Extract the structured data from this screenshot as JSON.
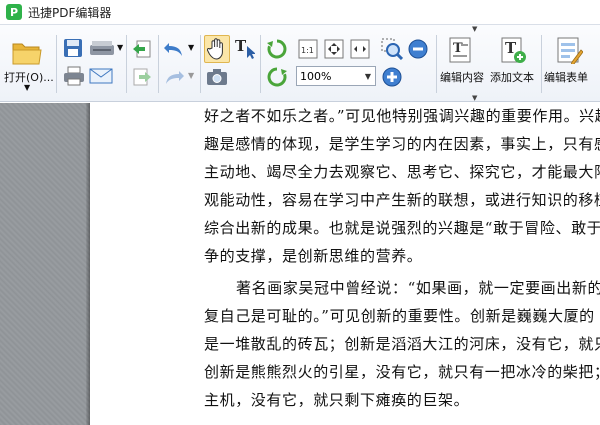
{
  "window": {
    "title": "迅捷PDF编辑器",
    "logo_letter": "P"
  },
  "toolbar": {
    "open_label": "打开(O)...",
    "zoom": {
      "value": "100%"
    },
    "edit_content_label": "编辑内容",
    "add_text_label": "添加文本",
    "edit_form_label": "编辑表单"
  },
  "document": {
    "lines": [
      "好之者不如乐之者。”可见他特别强调兴趣的重要作用。兴趣",
      "趣是感情的体现，是学生学习的内在因素，事实上，只有感",
      "主动地、竭尽全力去观察它、思考它、探究它，才能最大限",
      "观能动性，容易在学习中产生新的联想，或进行知识的移植",
      "综合出新的成果。也就是说强烈的兴趣是“敢于冒险、敢于向",
      "争的支撑，是创新思维的营养。",
      "著名画家吴冠中曾经说：“如果画，就一定要画出新的想",
      "复自己是可耻的。”可见创新的重要性。创新是巍巍大厦的",
      "是一堆散乱的砖瓦；创新是滔滔大江的河床，没有它，就只",
      "创新是熊熊烈火的引星，没有它，就只有一把冰冷的柴把；",
      "主机，没有它，就只剩下瘫痪的巨架。"
    ]
  }
}
